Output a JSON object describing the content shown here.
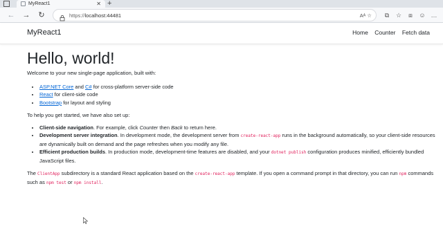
{
  "browser": {
    "tab_title": "MyReact1",
    "tab_close": "✕",
    "new_tab": "+",
    "back": "←",
    "forward": "→",
    "reload": "↻",
    "url_scheme": "https://",
    "url_host": "localhost:44481",
    "address_icons": "Aᴬ  ☆",
    "toolbar_icons": [
      "⧉",
      "☆",
      "⧈",
      "☺",
      "…"
    ]
  },
  "app": {
    "brand": "MyReact1",
    "nav": [
      "Home",
      "Counter",
      "Fetch data"
    ]
  },
  "content": {
    "heading": "Hello, world!",
    "intro": "Welcome to your new single-page application, built with:",
    "built_with": [
      {
        "link": "ASP.NET Core",
        "mid": " and ",
        "link2": "C#",
        "rest": " for cross-platform server-side code"
      },
      {
        "link": "React",
        "rest": " for client-side code"
      },
      {
        "link": "Bootstrap",
        "rest": " for layout and styling"
      }
    ],
    "setup_intro": "To help you get started, we have also set up:",
    "setup_items": [
      {
        "title": "Client-side navigation",
        "t1": ". For example, click ",
        "e1": "Counter",
        "t2": " then ",
        "e2": "Back",
        "t3": " to return here."
      },
      {
        "title": "Development server integration",
        "t1": ". In development mode, the development server from ",
        "c1": "create-react-app",
        "t2": " runs in the background automatically, so your client-side resources are dynamically built on demand and the page refreshes when you modify any file."
      },
      {
        "title": "Efficient production builds",
        "t1": ". In production mode, development-time features are disabled, and your ",
        "c1": "dotnet publish",
        "t2": " configuration produces minified, efficiently bundled JavaScript files."
      }
    ],
    "footer": {
      "t1": "The ",
      "c1": "ClientApp",
      "t2": " subdirectory is a standard React application based on the ",
      "c2": "create-react-app",
      "t3": " template. If you open a command prompt in that directory, you can run ",
      "c3": "npm",
      "t4": " commands such as ",
      "c4": "npm test",
      "t5": " or ",
      "c5": "npm install",
      "t6": "."
    }
  },
  "colors": {
    "link": "#0366d6",
    "code": "#e01e5a",
    "text": "#212529"
  }
}
